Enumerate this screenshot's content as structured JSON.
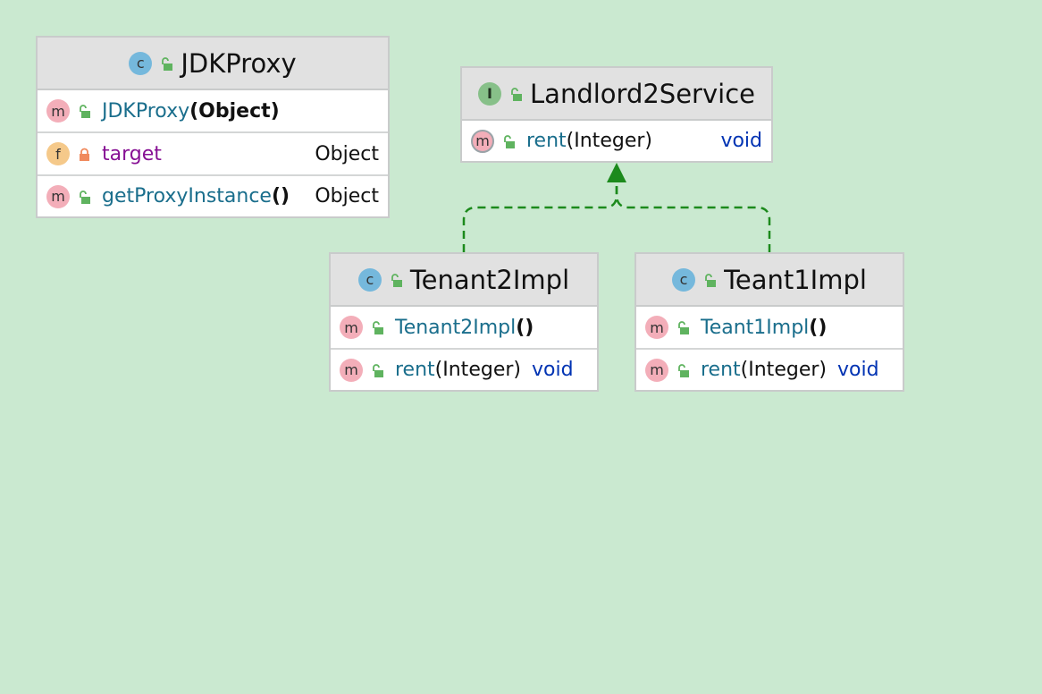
{
  "classes": {
    "jdkproxy": {
      "name": "JDKProxy",
      "kind_icon": "class-icon",
      "kind_letter": "c",
      "members": [
        {
          "kind": "m",
          "name": "JDKProxy",
          "sig": "(Object)",
          "type": ""
        },
        {
          "kind": "f",
          "name": "target",
          "sig": "",
          "type": "Object"
        },
        {
          "kind": "m",
          "name": "getProxyInstance",
          "sig": "()",
          "type": "Object"
        }
      ]
    },
    "landlord2service": {
      "name": "Landlord2Service",
      "kind_icon": "interface-icon",
      "kind_letter": "I",
      "members": [
        {
          "kind": "m",
          "name": "rent",
          "sig": "(Integer)",
          "type": "void"
        }
      ]
    },
    "tenant2impl": {
      "name": "Tenant2Impl",
      "kind_icon": "class-icon",
      "kind_letter": "c",
      "members": [
        {
          "kind": "m",
          "name": "Tenant2Impl",
          "sig": "()",
          "type": ""
        },
        {
          "kind": "m",
          "name": "rent",
          "sig": "(Integer)",
          "type": "void"
        }
      ]
    },
    "teant1impl": {
      "name": "Teant1Impl",
      "kind_icon": "class-icon",
      "kind_letter": "c",
      "members": [
        {
          "kind": "m",
          "name": "Teant1Impl",
          "sig": "()",
          "type": ""
        },
        {
          "kind": "m",
          "name": "rent",
          "sig": "(Integer)",
          "type": "void"
        }
      ]
    }
  },
  "edges": [
    {
      "from": "Tenant2Impl",
      "to": "Landlord2Service",
      "kind": "realization"
    },
    {
      "from": "Teant1Impl",
      "to": "Landlord2Service",
      "kind": "realization"
    }
  ],
  "colors": {
    "background": "#cae9d0",
    "edge": "#1c8a1c",
    "header": "#e1e1e1",
    "method_name": "#1a6e8c",
    "field_name": "#871094",
    "keyword": "#0033b3"
  }
}
